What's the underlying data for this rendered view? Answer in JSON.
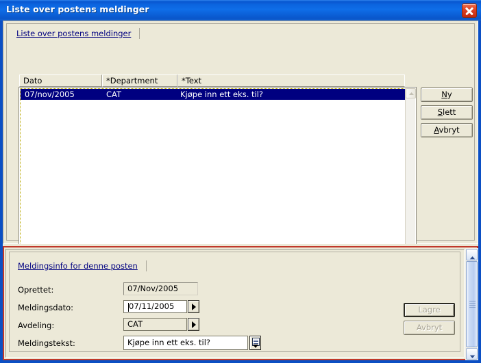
{
  "window": {
    "title": "Liste over postens meldinger",
    "close_label": "close-icon",
    "accent_titlebar": "#0b63de",
    "accent_panel_border": "#c0392b",
    "face_color": "#ece9d8",
    "selection_color": "#000080"
  },
  "top_panel": {
    "tab_label": "Liste over postens meldinger",
    "columns": [
      "Dato",
      "*Department",
      "*Text"
    ],
    "rows": [
      {
        "dato": "07/nov/2005",
        "department": "CAT",
        "text": "Kjøpe inn ett eks. til?",
        "selected": true
      }
    ],
    "buttons": [
      {
        "label": "Ny",
        "accel_prefix": "N",
        "accel_suffix": "y",
        "disabled": false
      },
      {
        "label": "Slett",
        "accel_prefix": "S",
        "accel_suffix": "lett",
        "disabled": false
      },
      {
        "label": "Avbryt",
        "accel_prefix": "A",
        "accel_suffix": "vbryt",
        "disabled": false
      }
    ]
  },
  "bottom_panel": {
    "tab_label": "Meldingsinfo for denne posten",
    "fields": [
      {
        "label": "Oprettet:",
        "value": "07/Nov/2005",
        "type": "readonly"
      },
      {
        "label": "Meldingsdato:",
        "value": "07/11/2005",
        "type": "date",
        "has_dropdown": true,
        "has_caret": true
      },
      {
        "label": "Avdeling:",
        "value": "CAT",
        "type": "combo",
        "has_dropdown": true
      },
      {
        "label": "Meldingstekst:",
        "value": "Kjøpe inn ett eks. til?",
        "type": "memo",
        "has_memo_button": true
      }
    ],
    "buttons": [
      {
        "label": "Lagre",
        "disabled": true,
        "default": true
      },
      {
        "label": "Avbryt",
        "disabled": true,
        "default": false
      }
    ]
  }
}
